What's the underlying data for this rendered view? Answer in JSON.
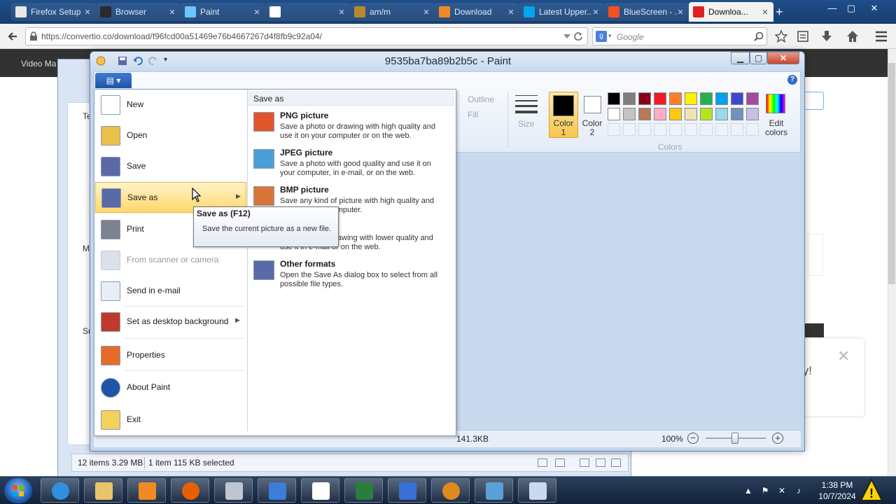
{
  "browser": {
    "tabs": [
      {
        "label": "Firefox Setup ...",
        "icon_color": "#e8e8e8"
      },
      {
        "label": "Browser",
        "icon_color": "#2b2b2b"
      },
      {
        "label": "Paint",
        "icon_color": "#6cc6ff"
      },
      {
        "label": "",
        "icon_color": "#ffffff"
      },
      {
        "label": "am/m",
        "icon_color": "#b7892e"
      },
      {
        "label": "Download",
        "icon_color": "#f08a24"
      },
      {
        "label": "Latest Upper...",
        "icon_color": "#00a4ef"
      },
      {
        "label": "BlueScreen - ...",
        "icon_color": "#f25022"
      },
      {
        "label": "Downloa...",
        "icon_color": "#e02020",
        "active": true
      }
    ],
    "tab_close": "✕",
    "new_tab": "+",
    "url": "https://convertio.co/download/f96fcd00a51469e76b4667267d4f8fb9c92a04/",
    "search_placeholder": "Google",
    "window_controls": [
      "—",
      "▢",
      "✕"
    ]
  },
  "site": {
    "nav_label": "Video Ma",
    "side_labels": [
      "Te",
      "Mo",
      "Su"
    ],
    "partial_text": "ty!"
  },
  "explorer": {
    "status_items": "12 items 3.29 MB",
    "status_selected": "1 item 115 KB selected"
  },
  "paint": {
    "title": "9535ba7ba89b2b5c - Paint",
    "menu_button_glyph": "▤ ▾",
    "help": "?",
    "ribbon": {
      "outline": "Outline",
      "fill": "Fill",
      "size": "Size",
      "color1": "Color 1",
      "color2": "Color 2",
      "colors_group": "Colors",
      "edit_colors": "Edit colors",
      "palette_row1": [
        "#000000",
        "#7f7f7f",
        "#880015",
        "#ed1c24",
        "#ff7f27",
        "#fff200",
        "#22b14c",
        "#00a2e8",
        "#3f48cc",
        "#a349a4"
      ],
      "palette_row2": [
        "#ffffff",
        "#c3c3c3",
        "#b97a57",
        "#ffaec9",
        "#ffc90e",
        "#efe4b0",
        "#b5e61d",
        "#99d9ea",
        "#7092be",
        "#c8bfe7"
      ]
    },
    "app_menu": {
      "items": [
        {
          "label": "New",
          "icon": "new-file-icon",
          "color": "#ffffff",
          "disabled": false,
          "submenu": false
        },
        {
          "label": "Open",
          "icon": "open-folder-icon",
          "color": "#e8c04a",
          "disabled": false,
          "submenu": false
        },
        {
          "label": "Save",
          "icon": "save-disk-icon",
          "color": "#5a6aa8",
          "disabled": false,
          "submenu": false
        },
        {
          "label": "Save as",
          "icon": "save-as-icon",
          "color": "#5a6aa8",
          "disabled": false,
          "submenu": true,
          "hover": true
        },
        {
          "label": "Print",
          "icon": "printer-icon",
          "color": "#7b8290",
          "disabled": false,
          "submenu": true
        },
        {
          "label": "From scanner or camera",
          "icon": "scanner-icon",
          "color": "#b8c4d4",
          "disabled": true,
          "submenu": false
        },
        {
          "label": "Send in e-mail",
          "icon": "email-icon",
          "color": "#e8eef7",
          "disabled": false,
          "submenu": false
        },
        {
          "label": "Set as desktop background",
          "icon": "desktop-background-icon",
          "color": "#c0392b",
          "disabled": false,
          "submenu": true
        },
        {
          "label": "Properties",
          "icon": "checkmark-icon",
          "color": "#e86a2a",
          "disabled": false,
          "submenu": false
        },
        {
          "label": "About Paint",
          "icon": "info-icon",
          "color": "#1f55a8",
          "disabled": false,
          "submenu": false
        },
        {
          "label": "Exit",
          "icon": "exit-icon",
          "color": "#f2d25b",
          "disabled": false,
          "submenu": false
        }
      ],
      "submenu_arrow": "▶"
    },
    "save_as_panel": {
      "heading": "Save as",
      "options": [
        {
          "title": "PNG picture",
          "desc": "Save a photo or drawing with high quality and use it on your computer or on the web.",
          "icon": "png-icon",
          "color": "#e0562a"
        },
        {
          "title": "JPEG picture",
          "desc": "Save a photo with good quality and use it on your computer, in e-mail, or on the web.",
          "icon": "jpeg-icon",
          "color": "#4a9fd6"
        },
        {
          "title": "BMP picture",
          "desc": "Save any kind of picture with high quality and use it on your computer.",
          "icon": "bmp-icon",
          "color": "#d9743a"
        },
        {
          "title": "",
          "desc": "Save a simple drawing with lower quality and use it in e-mail or on the web.",
          "icon": "gif-icon",
          "color": "#9cb6d8"
        },
        {
          "title": "Other formats",
          "desc": "Open the Save As dialog box to select from all possible file types.",
          "icon": "other-formats-icon",
          "color": "#5a6aa8"
        }
      ]
    },
    "tooltip": {
      "title": "Save as (F12)",
      "desc": "Save the current picture as a new file."
    },
    "status": {
      "size": "141.3KB",
      "zoom": "100%",
      "zoom_minus": "−",
      "zoom_plus": "+"
    }
  },
  "taskbar": {
    "apps": [
      {
        "icon": "internet-explorer-icon",
        "color": "#2f8fe0"
      },
      {
        "icon": "file-explorer-icon",
        "color": "#e9c46a"
      },
      {
        "icon": "media-player-icon",
        "color": "#f08a24"
      },
      {
        "icon": "firefox-icon",
        "color": "#e66000"
      },
      {
        "icon": "drive-icon",
        "color": "#bfc6cf"
      },
      {
        "icon": "control-panel-icon",
        "color": "#3b7dd8"
      },
      {
        "icon": "panda-icon",
        "color": "#ffffff"
      },
      {
        "icon": "terminal-icon",
        "color": "#2a7d3a"
      },
      {
        "icon": "jet-icon",
        "color": "#3a6fd8"
      },
      {
        "icon": "globe-icon",
        "color": "#e08a1e"
      },
      {
        "icon": "image-viewer-icon",
        "color": "#5aa0d8"
      },
      {
        "icon": "paint-icon",
        "color": "#c9d9ee"
      }
    ],
    "tray_icons": [
      "▲",
      "⚑",
      "✕",
      "♪"
    ],
    "time": "1:38 PM",
    "date": "10/7/2024",
    "warning": "!"
  }
}
